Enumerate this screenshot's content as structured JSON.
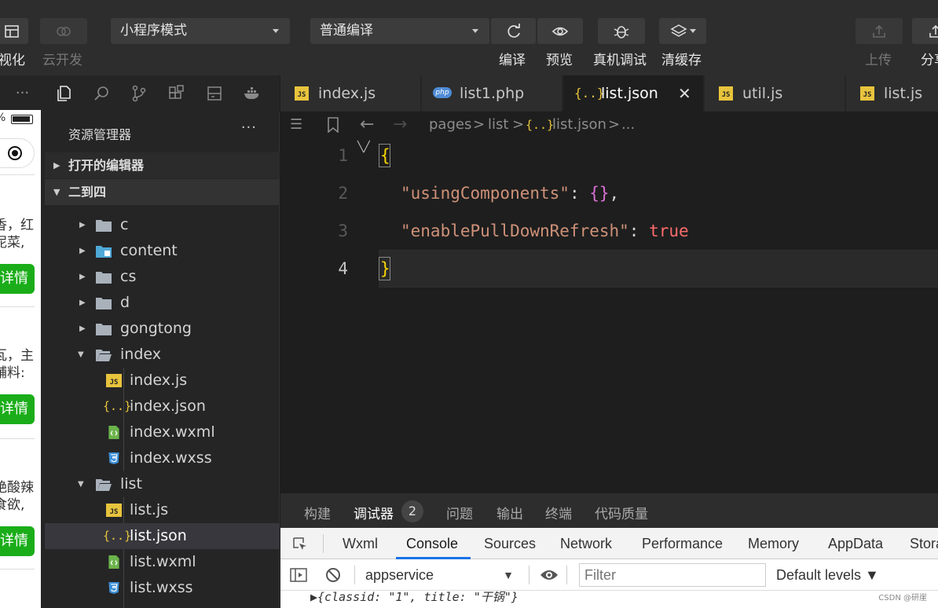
{
  "toolbar": {
    "visual_label": "视化",
    "cloud_label": "云开发",
    "mode_select": "小程序模式",
    "compile_select": "普通编译",
    "compile_label": "编译",
    "preview_label": "预览",
    "device_debug_label": "真机调试",
    "clear_cache_label": "清缓存",
    "upload_label": "上传",
    "share_label": "分享"
  },
  "simulator": {
    "battery_text": "%",
    "cards": [
      {
        "line1": "香，红",
        "line2": "泥菜,",
        "button": "详情"
      },
      {
        "line1": "瓦，主",
        "line2": "辅料:",
        "button": "详情"
      },
      {
        "line1": "艳酸辣",
        "line2": "食欲,",
        "button": "详情"
      }
    ]
  },
  "sidebar": {
    "more_glyph": "···",
    "explorer_title": "资源管理器",
    "explorer_more": "···",
    "open_editors": "打开的编辑器",
    "workspace": "二到四",
    "tree": [
      {
        "label": "c"
      },
      {
        "label": "content"
      },
      {
        "label": "cs"
      },
      {
        "label": "d"
      },
      {
        "label": "gongtong"
      },
      {
        "label": "index"
      },
      {
        "label": "index.js"
      },
      {
        "label": "index.json"
      },
      {
        "label": "index.wxml"
      },
      {
        "label": "index.wxss"
      },
      {
        "label": "list"
      },
      {
        "label": "list.js"
      },
      {
        "label": "list.json"
      },
      {
        "label": "list.wxml"
      },
      {
        "label": "list.wxss"
      }
    ]
  },
  "tabs": [
    {
      "label": "index.js",
      "icon": "JS"
    },
    {
      "label": "list1.php",
      "icon": "php"
    },
    {
      "label": "list.json",
      "icon": "{..}"
    },
    {
      "label": "util.js",
      "icon": "JS"
    },
    {
      "label": "list.js",
      "icon": "JS"
    }
  ],
  "breadcrumb": {
    "p1": "pages",
    "p2": "list",
    "json_icon": "{..}",
    "p3": "list.json",
    "p4": "..."
  },
  "code": {
    "line_numbers": [
      "1",
      "2",
      "3",
      "4"
    ],
    "open_brace": "{",
    "key1": "\"usingComponents\"",
    "colon1": ": ",
    "val1": "{}",
    "comma1": ",",
    "key2": "\"enablePullDownRefresh\"",
    "colon2": ": ",
    "val2": "true",
    "close_brace": "}"
  },
  "panel_tabs": {
    "build": "构建",
    "debugger": "调试器",
    "badge": "2",
    "problems": "问题",
    "output": "输出",
    "terminal": "终端",
    "quality": "代码质量"
  },
  "devtools": {
    "tabs": [
      "Wxml",
      "Console",
      "Sources",
      "Network",
      "Performance",
      "Memory",
      "AppData",
      "Storage"
    ],
    "context": "appservice",
    "filter_placeholder": "Filter",
    "levels": "Default levels ▼"
  },
  "console": {
    "line": "▶{classid: \"1\", title: \"干锅\"}"
  },
  "watermark": "CSDN @研崖",
  "colors": {
    "accent_green": "#1aad19",
    "js_yellow": "#e8c43d",
    "json_brace": "#ffd700",
    "bool_red": "#ff6b6b"
  }
}
